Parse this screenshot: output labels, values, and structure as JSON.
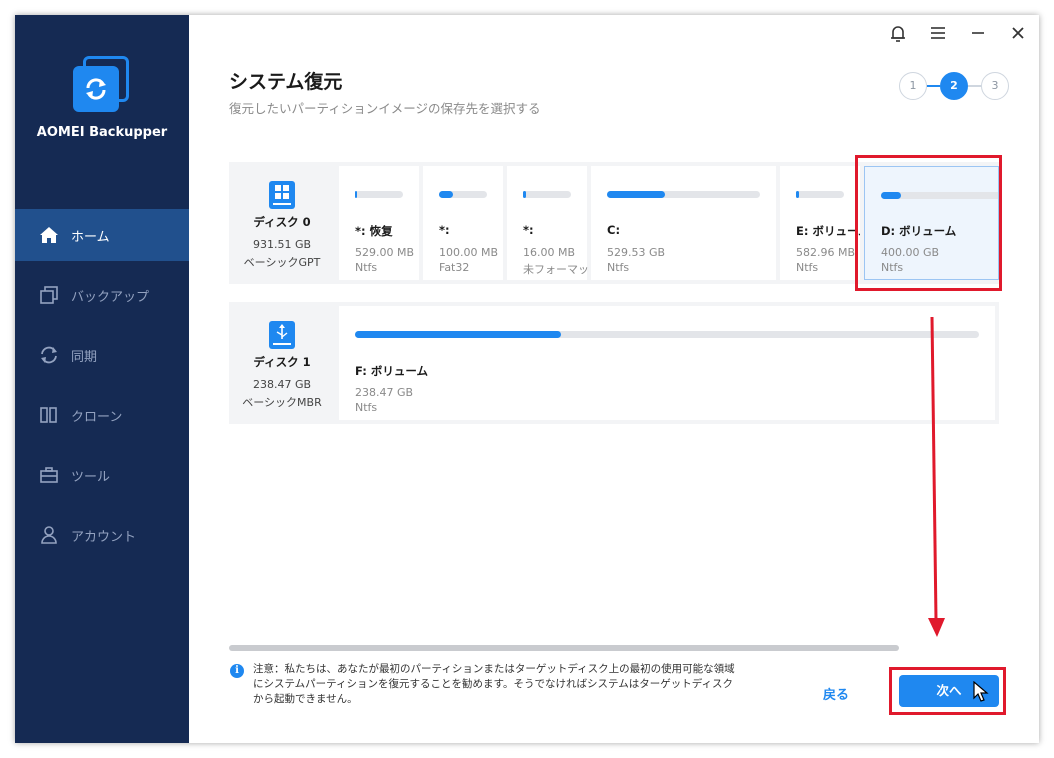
{
  "app": {
    "name": "AOMEI Backupper"
  },
  "nav": [
    {
      "label": "ホーム",
      "icon": "home-icon",
      "active": true
    },
    {
      "label": "バックアップ",
      "icon": "backup-icon",
      "active": false
    },
    {
      "label": "同期",
      "icon": "sync-icon",
      "active": false
    },
    {
      "label": "クローン",
      "icon": "clone-icon",
      "active": false
    },
    {
      "label": "ツール",
      "icon": "tools-icon",
      "active": false
    },
    {
      "label": "アカウント",
      "icon": "account-icon",
      "active": false
    }
  ],
  "page": {
    "title": "システム復元",
    "subtitle": "復元したいパーティションイメージの保存先を選択する"
  },
  "steps": {
    "items": [
      "1",
      "2",
      "3"
    ],
    "current": 2
  },
  "disks": [
    {
      "name": "ディスク 0",
      "size": "931.51 GB",
      "type": "ベーシックGPT",
      "icon": "windows-disk-icon",
      "partitions": [
        {
          "name": "*: 恢复",
          "size": "529.00 MB",
          "fs": "Ntfs",
          "used": 0.04
        },
        {
          "name": "*:",
          "size": "100.00 MB",
          "fs": "Fat32",
          "used": 0.3
        },
        {
          "name": "*:",
          "size": "16.00 MB",
          "fs": "未フォーマット",
          "used": 0.06
        },
        {
          "name": "C:",
          "size": "529.53 GB",
          "fs": "Ntfs",
          "used": 0.38
        },
        {
          "name": "E: ボリューム",
          "size": "582.96 MB",
          "fs": "Ntfs",
          "used": 0.06
        },
        {
          "name": "D: ボリューム",
          "size": "400.00 GB",
          "fs": "Ntfs",
          "used": 0.15,
          "selected": true
        }
      ]
    },
    {
      "name": "ディスク 1",
      "size": "238.47 GB",
      "type": "ベーシックMBR",
      "icon": "usb-disk-icon",
      "partitions": [
        {
          "name": "F: ボリューム",
          "size": "238.47 GB",
          "fs": "Ntfs",
          "used": 0.33
        }
      ]
    }
  ],
  "footer": {
    "note": "注意：私たちは、あなたが最初のパーティションまたはターゲットディスク上の最初の使用可能な領域にシステムパーティションを復元することを勧めます。そうでなければシステムはターゲットディスクから起動できません。",
    "back_label": "戻る",
    "next_label": "次へ"
  },
  "colors": {
    "accent": "#1f88f0",
    "sidebar": "#152a53",
    "sidebar_active": "#21508d",
    "annotation": "#e0192c"
  }
}
